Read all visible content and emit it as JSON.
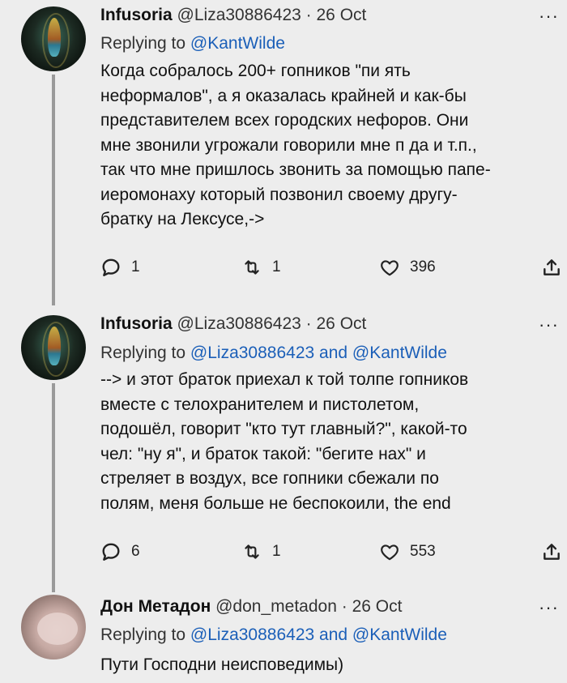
{
  "tweets": [
    {
      "name": "Infusoria",
      "handle": "@Liza30886423",
      "date": "26 Oct",
      "replying_prefix": "Replying to",
      "mentions": "@KantWilde",
      "text": "Когда собралось 200+ гопников \"пи    ять\nнеформалов\", а я оказалась крайней и как-бы\nпредставителем всех городских нефоров. Они\nмне звонили угрожали говорили мне п     да и т.п.,\nтак что мне пришлось звонить за помощью папе-\nиеромонаху который позвонил своему другу-\nбратку на Лексусе,->",
      "reply_count": "1",
      "retweet_count": "1",
      "like_count": "396"
    },
    {
      "name": "Infusoria",
      "handle": "@Liza30886423",
      "date": "26 Oct",
      "replying_prefix": "Replying to",
      "mentions": "@Liza30886423 and @KantWilde",
      "text": "--> и этот браток приехал к той толпе гопников\nвместе с телохранителем и пистолетом,\nподошёл, говорит \"кто тут главный?\", какой-то\nчел: \"ну я\", и браток такой: \"бегите нах\" и\nстреляет в воздух, все гопники сбежали по\nполям, меня больше не беспокоили, the end",
      "reply_count": "6",
      "retweet_count": "1",
      "like_count": "553"
    },
    {
      "name": "Дон Метадон",
      "handle": "@don_metadon",
      "date": "26 Oct",
      "replying_prefix": "Replying to",
      "mentions": "@Liza30886423 and @KantWilde",
      "text": "Пути Господни неисповедимы)"
    }
  ],
  "sep": "·",
  "more_label": "···",
  "colors": {
    "background": "#ededed",
    "link": "#1b5fb8",
    "thread_line": "#9a9a9a"
  },
  "icons": [
    "reply-icon",
    "retweet-icon",
    "like-icon",
    "share-icon",
    "more-icon"
  ]
}
